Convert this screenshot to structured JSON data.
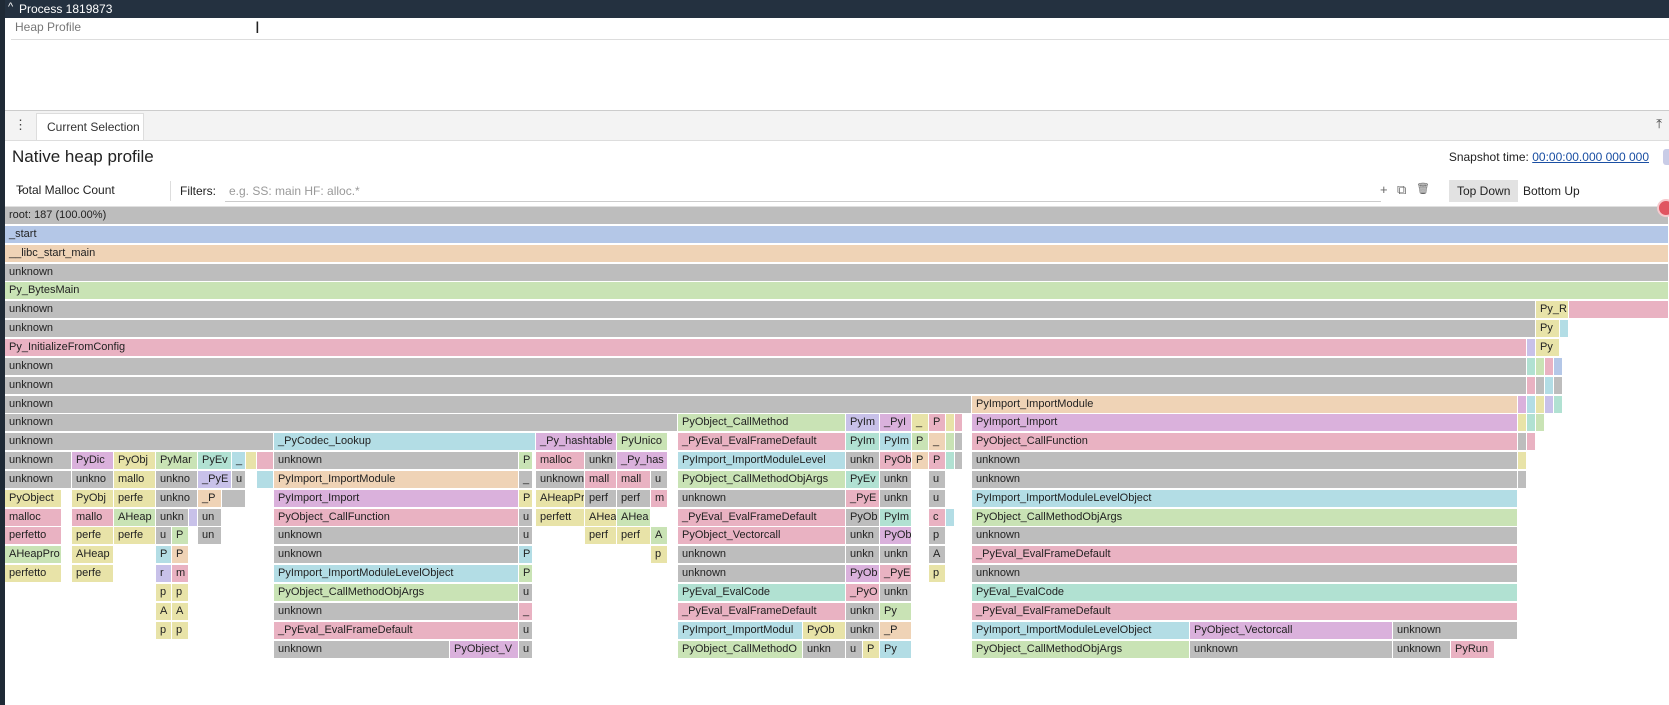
{
  "process": {
    "chevron": "^",
    "title": "Process 1819873"
  },
  "track": {
    "label": "Heap Profile",
    "cursor": "I"
  },
  "tabs": {
    "menu_icon": "⋮",
    "current": "Current Selection",
    "pin_icon": "⤒"
  },
  "panel": {
    "title": "Native heap profile",
    "snapshot_label": "Snapshot time: ",
    "snapshot_time": "00:00:00.000 000 000"
  },
  "toolbar": {
    "metric": "Total Malloc Count",
    "dropdown_icon": "⌄",
    "filters_label": "Filters:",
    "filters_placeholder": "e.g. SS: main HF: alloc.*",
    "add_icon": "+",
    "copy_icon": "⧉",
    "delete_icon": "🗑",
    "top_down": "Top Down",
    "bottom_up": "Bottom Up"
  },
  "colors": {
    "gray": "#bdbdbd",
    "blue": "#b4c7e7",
    "orange": "#efd3b6",
    "green": "#c9e3b5",
    "pink": "#e9b2c2",
    "cyan": "#b3dde5",
    "violet": "#dab1dc",
    "teal": "#b1e1d2",
    "yellow": "#e8e3a8",
    "lilac": "#c8c1e9"
  },
  "flame_rows": [
    [
      [
        5,
        1669,
        "gray",
        "root: 187 (100.00%)"
      ]
    ],
    [
      [
        5,
        1669,
        "blue",
        "_start"
      ]
    ],
    [
      [
        5,
        1669,
        "orange",
        "__libc_start_main"
      ]
    ],
    [
      [
        5,
        1669,
        "gray",
        "unknown"
      ]
    ],
    [
      [
        5,
        1669,
        "green",
        "Py_BytesMain"
      ]
    ],
    [
      [
        5,
        1536,
        "gray",
        "unknown"
      ],
      [
        1536,
        1569,
        "yellow",
        "Py_R"
      ],
      [
        1569,
        1669,
        "pink",
        ""
      ]
    ],
    [
      [
        5,
        1536,
        "gray",
        "unknown"
      ],
      [
        1536,
        1560,
        "yellow",
        "Py"
      ],
      [
        1560,
        1569,
        "cyan",
        ""
      ]
    ],
    [
      [
        5,
        1527,
        "pink",
        "Py_InitializeFromConfig"
      ],
      [
        1527,
        1536,
        "lilac",
        ""
      ],
      [
        1536,
        1560,
        "yellow",
        "Py"
      ]
    ],
    [
      [
        5,
        1527,
        "gray",
        "unknown"
      ],
      [
        1527,
        1536,
        "teal",
        ""
      ],
      [
        1536,
        1545,
        "green",
        ""
      ],
      [
        1545,
        1554,
        "pink",
        ""
      ],
      [
        1554,
        1563,
        "blue",
        ""
      ]
    ],
    [
      [
        5,
        1527,
        "gray",
        "unknown"
      ],
      [
        1527,
        1536,
        "pink",
        ""
      ],
      [
        1536,
        1545,
        "gray",
        ""
      ],
      [
        1545,
        1554,
        "cyan",
        ""
      ],
      [
        1554,
        1563,
        "gray",
        ""
      ]
    ],
    [
      [
        5,
        972,
        "gray",
        "unknown"
      ],
      [
        972,
        1518,
        "orange",
        "PyImport_ImportModule"
      ],
      [
        1518,
        1527,
        "violet",
        ""
      ],
      [
        1527,
        1536,
        "cyan",
        ""
      ],
      [
        1536,
        1545,
        "yellow",
        ""
      ],
      [
        1545,
        1554,
        "lilac",
        ""
      ],
      [
        1554,
        1563,
        "teal",
        ""
      ]
    ],
    [
      [
        5,
        678,
        "gray",
        "unknown"
      ],
      [
        678,
        846,
        "green",
        "PyObject_CallMethod"
      ],
      [
        846,
        880,
        "lilac",
        "PyIm"
      ],
      [
        880,
        912,
        "violet",
        "_PyI"
      ],
      [
        912,
        929,
        "yellow",
        "_"
      ],
      [
        929,
        946,
        "pink",
        "P"
      ],
      [
        946,
        955,
        "yellow",
        ""
      ],
      [
        955,
        963,
        "pink",
        ""
      ],
      [
        972,
        1518,
        "violet",
        "PyImport_Import"
      ],
      [
        1518,
        1527,
        "yellow",
        ""
      ],
      [
        1527,
        1536,
        "teal",
        ""
      ],
      [
        1536,
        1545,
        "green",
        ""
      ]
    ],
    [
      [
        5,
        274,
        "gray",
        "unknown"
      ],
      [
        274,
        536,
        "cyan",
        "_PyCodec_Lookup"
      ],
      [
        536,
        617,
        "violet",
        "_Py_hashtable"
      ],
      [
        617,
        668,
        "green",
        "PyUnico"
      ],
      [
        678,
        846,
        "pink",
        "_PyEval_EvalFrameDefault"
      ],
      [
        846,
        880,
        "teal",
        "PyIm"
      ],
      [
        880,
        912,
        "cyan",
        "PyIm"
      ],
      [
        912,
        929,
        "green",
        "P"
      ],
      [
        929,
        946,
        "orange",
        "_"
      ],
      [
        946,
        955,
        "green",
        ""
      ],
      [
        955,
        963,
        "gray",
        ""
      ],
      [
        972,
        1518,
        "pink",
        "PyObject_CallFunction"
      ],
      [
        1518,
        1527,
        "gray",
        ""
      ],
      [
        1527,
        1536,
        "pink",
        ""
      ]
    ],
    [
      [
        5,
        72,
        "gray",
        "unknown"
      ],
      [
        72,
        114,
        "violet",
        "PyDic"
      ],
      [
        114,
        156,
        "yellow",
        "PyObj"
      ],
      [
        156,
        198,
        "green",
        "PyMar"
      ],
      [
        198,
        232,
        "teal",
        "PyEv"
      ],
      [
        232,
        246,
        "cyan",
        "_"
      ],
      [
        246,
        257,
        "yellow",
        ""
      ],
      [
        257,
        274,
        "pink",
        ""
      ],
      [
        274,
        519,
        "gray",
        "unknown"
      ],
      [
        519,
        533,
        "green",
        "P"
      ],
      [
        536,
        585,
        "pink",
        "malloc"
      ],
      [
        585,
        617,
        "gray",
        "unkn"
      ],
      [
        617,
        668,
        "violet",
        "_Py_has"
      ],
      [
        678,
        846,
        "cyan",
        "PyImport_ImportModuleLevel"
      ],
      [
        846,
        880,
        "gray",
        "unkn"
      ],
      [
        880,
        912,
        "pink",
        "PyOb"
      ],
      [
        912,
        929,
        "orange",
        "P"
      ],
      [
        929,
        946,
        "pink",
        "P"
      ],
      [
        946,
        955,
        "teal",
        ""
      ],
      [
        955,
        963,
        "gray",
        ""
      ],
      [
        972,
        1518,
        "gray",
        "unknown"
      ],
      [
        1518,
        1527,
        "yellow",
        ""
      ]
    ],
    [
      [
        5,
        72,
        "gray",
        "unknown"
      ],
      [
        72,
        114,
        "gray",
        "unkno"
      ],
      [
        114,
        156,
        "yellow",
        "mallo"
      ],
      [
        156,
        198,
        "gray",
        "unkno"
      ],
      [
        198,
        232,
        "lilac",
        "_PyE"
      ],
      [
        232,
        246,
        "gray",
        "u"
      ],
      [
        257,
        274,
        "cyan",
        ""
      ],
      [
        274,
        519,
        "orange",
        "PyImport_ImportModule"
      ],
      [
        519,
        533,
        "gray",
        "_"
      ],
      [
        536,
        585,
        "gray",
        "unknown"
      ],
      [
        585,
        617,
        "pink",
        "mall"
      ],
      [
        617,
        651,
        "pink",
        "mall"
      ],
      [
        651,
        668,
        "gray",
        "u"
      ],
      [
        678,
        846,
        "green",
        "PyObject_CallMethodObjArgs"
      ],
      [
        846,
        880,
        "teal",
        "PyEv"
      ],
      [
        880,
        912,
        "gray",
        "unkn"
      ],
      [
        929,
        946,
        "gray",
        "u"
      ],
      [
        972,
        1518,
        "gray",
        "unknown"
      ],
      [
        1518,
        1527,
        "gray",
        ""
      ]
    ],
    [
      [
        5,
        62,
        "yellow",
        "PyObject"
      ],
      [
        72,
        114,
        "yellow",
        "PyObj"
      ],
      [
        114,
        156,
        "yellow",
        "perfe"
      ],
      [
        156,
        198,
        "gray",
        "unkno"
      ],
      [
        198,
        222,
        "orange",
        "_P"
      ],
      [
        222,
        246,
        "gray",
        ""
      ],
      [
        274,
        519,
        "violet",
        "PyImport_Import"
      ],
      [
        519,
        533,
        "yellow",
        "P"
      ],
      [
        536,
        585,
        "yellow",
        "AHeapPr"
      ],
      [
        585,
        617,
        "gray",
        "perf"
      ],
      [
        617,
        651,
        "gray",
        "perf"
      ],
      [
        651,
        668,
        "pink",
        "m"
      ],
      [
        678,
        846,
        "gray",
        "unknown"
      ],
      [
        846,
        880,
        "pink",
        "_PyE"
      ],
      [
        880,
        912,
        "gray",
        "unkn"
      ],
      [
        929,
        946,
        "gray",
        "u"
      ],
      [
        972,
        1518,
        "cyan",
        "PyImport_ImportModuleLevelObject"
      ]
    ],
    [
      [
        5,
        62,
        "pink",
        "malloc"
      ],
      [
        72,
        114,
        "pink",
        "mallo"
      ],
      [
        114,
        156,
        "green",
        "AHeap"
      ],
      [
        156,
        189,
        "gray",
        "unkn"
      ],
      [
        189,
        198,
        "lilac",
        ""
      ],
      [
        198,
        222,
        "gray",
        "un"
      ],
      [
        274,
        519,
        "pink",
        "PyObject_CallFunction"
      ],
      [
        519,
        533,
        "gray",
        "u"
      ],
      [
        536,
        585,
        "yellow",
        "perfett"
      ],
      [
        585,
        617,
        "yellow",
        "AHea"
      ],
      [
        617,
        651,
        "green",
        "AHea"
      ],
      [
        678,
        846,
        "pink",
        "_PyEval_EvalFrameDefault"
      ],
      [
        846,
        880,
        "gray",
        "PyOb"
      ],
      [
        880,
        912,
        "teal",
        "PyIm"
      ],
      [
        929,
        946,
        "pink",
        "c"
      ],
      [
        946,
        955,
        "cyan",
        ""
      ],
      [
        972,
        1518,
        "green",
        "PyObject_CallMethodObjArgs"
      ]
    ],
    [
      [
        5,
        62,
        "pink",
        "perfetto"
      ],
      [
        72,
        114,
        "yellow",
        "perfe"
      ],
      [
        114,
        156,
        "yellow",
        "perfe"
      ],
      [
        156,
        172,
        "gray",
        "u"
      ],
      [
        172,
        189,
        "green",
        "P"
      ],
      [
        198,
        222,
        "gray",
        "un"
      ],
      [
        274,
        519,
        "gray",
        "unknown"
      ],
      [
        519,
        533,
        "gray",
        "u"
      ],
      [
        585,
        617,
        "yellow",
        "perf"
      ],
      [
        617,
        651,
        "yellow",
        "perf"
      ],
      [
        651,
        668,
        "green",
        "A"
      ],
      [
        678,
        846,
        "pink",
        "PyObject_Vectorcall"
      ],
      [
        846,
        880,
        "gray",
        "unkn"
      ],
      [
        880,
        912,
        "violet",
        "PyOb"
      ],
      [
        929,
        946,
        "gray",
        "p"
      ],
      [
        972,
        1518,
        "gray",
        "unknown"
      ]
    ],
    [
      [
        5,
        62,
        "green",
        "AHeapPro"
      ],
      [
        72,
        114,
        "yellow",
        "AHeap"
      ],
      [
        156,
        172,
        "cyan",
        "P"
      ],
      [
        172,
        189,
        "orange",
        "P"
      ],
      [
        274,
        519,
        "gray",
        "unknown"
      ],
      [
        519,
        533,
        "cyan",
        "P"
      ],
      [
        651,
        668,
        "yellow",
        "p"
      ],
      [
        678,
        846,
        "gray",
        "unknown"
      ],
      [
        846,
        880,
        "gray",
        "unkn"
      ],
      [
        880,
        912,
        "gray",
        "unkn"
      ],
      [
        929,
        946,
        "gray",
        "A"
      ],
      [
        972,
        1518,
        "pink",
        "_PyEval_EvalFrameDefault"
      ]
    ],
    [
      [
        5,
        62,
        "yellow",
        "perfetto"
      ],
      [
        72,
        114,
        "yellow",
        "perfe"
      ],
      [
        156,
        172,
        "lilac",
        "r"
      ],
      [
        172,
        189,
        "pink",
        "m"
      ],
      [
        274,
        519,
        "cyan",
        "PyImport_ImportModuleLevelObject"
      ],
      [
        519,
        533,
        "green",
        "P"
      ],
      [
        678,
        846,
        "gray",
        "unknown"
      ],
      [
        846,
        880,
        "violet",
        "PyOb"
      ],
      [
        880,
        912,
        "pink",
        "_PyE"
      ],
      [
        929,
        946,
        "yellow",
        "p"
      ],
      [
        972,
        1518,
        "gray",
        "unknown"
      ]
    ],
    [
      [
        156,
        172,
        "yellow",
        "p"
      ],
      [
        172,
        189,
        "yellow",
        "p"
      ],
      [
        274,
        519,
        "green",
        "PyObject_CallMethodObjArgs"
      ],
      [
        519,
        533,
        "gray",
        "u"
      ],
      [
        678,
        846,
        "teal",
        "PyEval_EvalCode"
      ],
      [
        846,
        880,
        "pink",
        "_PyO"
      ],
      [
        880,
        912,
        "gray",
        "unkn"
      ],
      [
        972,
        1518,
        "teal",
        "PyEval_EvalCode"
      ]
    ],
    [
      [
        156,
        172,
        "yellow",
        "A"
      ],
      [
        172,
        189,
        "yellow",
        "A"
      ],
      [
        274,
        519,
        "gray",
        "unknown"
      ],
      [
        519,
        533,
        "pink",
        "_"
      ],
      [
        678,
        846,
        "pink",
        "_PyEval_EvalFrameDefault"
      ],
      [
        846,
        880,
        "gray",
        "unkn"
      ],
      [
        880,
        912,
        "green",
        "Py"
      ],
      [
        972,
        1518,
        "pink",
        "_PyEval_EvalFrameDefault"
      ]
    ],
    [
      [
        156,
        172,
        "yellow",
        "p"
      ],
      [
        172,
        189,
        "yellow",
        "p"
      ],
      [
        274,
        519,
        "pink",
        "_PyEval_EvalFrameDefault"
      ],
      [
        519,
        533,
        "gray",
        "u"
      ],
      [
        678,
        803,
        "cyan",
        "PyImport_ImportModul"
      ],
      [
        803,
        846,
        "yellow",
        "PyOb"
      ],
      [
        846,
        880,
        "gray",
        "unkn"
      ],
      [
        880,
        912,
        "orange",
        "_P"
      ],
      [
        972,
        1190,
        "cyan",
        "PyImport_ImportModuleLevelObject"
      ],
      [
        1190,
        1393,
        "violet",
        "PyObject_Vectorcall"
      ],
      [
        1393,
        1518,
        "gray",
        "unknown"
      ]
    ],
    [
      [
        274,
        450,
        "gray",
        "unknown"
      ],
      [
        450,
        519,
        "violet",
        "PyObject_V"
      ],
      [
        519,
        533,
        "gray",
        "u"
      ],
      [
        678,
        803,
        "green",
        "PyObject_CallMethodO"
      ],
      [
        803,
        846,
        "gray",
        "unkn"
      ],
      [
        846,
        863,
        "gray",
        "u"
      ],
      [
        863,
        880,
        "yellow",
        "P"
      ],
      [
        880,
        912,
        "cyan",
        "Py"
      ],
      [
        972,
        1190,
        "green",
        "PyObject_CallMethodObjArgs"
      ],
      [
        1190,
        1393,
        "gray",
        "unknown"
      ],
      [
        1393,
        1451,
        "gray",
        "unknown"
      ],
      [
        1451,
        1495,
        "pink",
        "PyRun"
      ]
    ]
  ]
}
